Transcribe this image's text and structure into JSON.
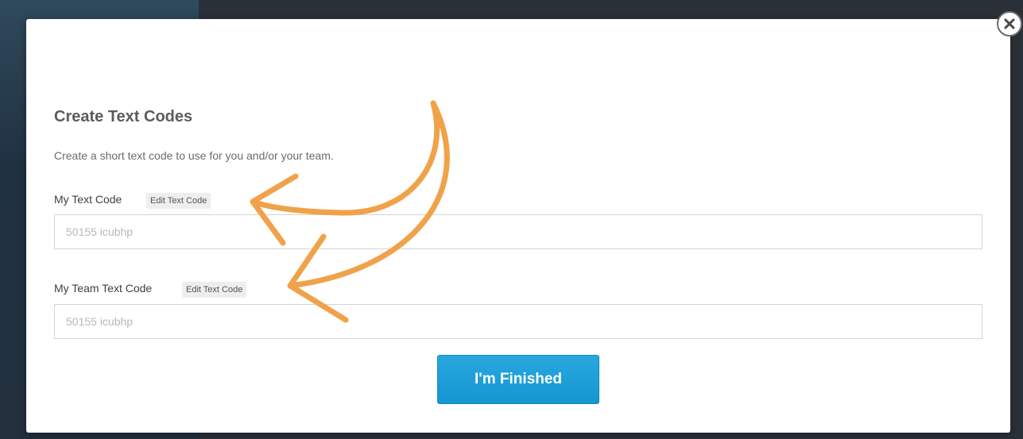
{
  "modal": {
    "title": "Create Text Codes",
    "subtitle": "Create a short text code to use for you and/or your team.",
    "close_icon": "close-icon",
    "fields": [
      {
        "label": "My Text Code",
        "edit_label": "Edit Text Code",
        "placeholder": "50155 icubhp"
      },
      {
        "label": "My Team Text Code",
        "edit_label": "Edit Text Code",
        "placeholder": "50155 icubhp"
      }
    ],
    "finish_label": "I'm Finished"
  },
  "colors": {
    "accent": "#1a9fd8",
    "annotation": "#f0a24a",
    "title_text": "#5c5c5c",
    "overlay": "#2a3038"
  }
}
